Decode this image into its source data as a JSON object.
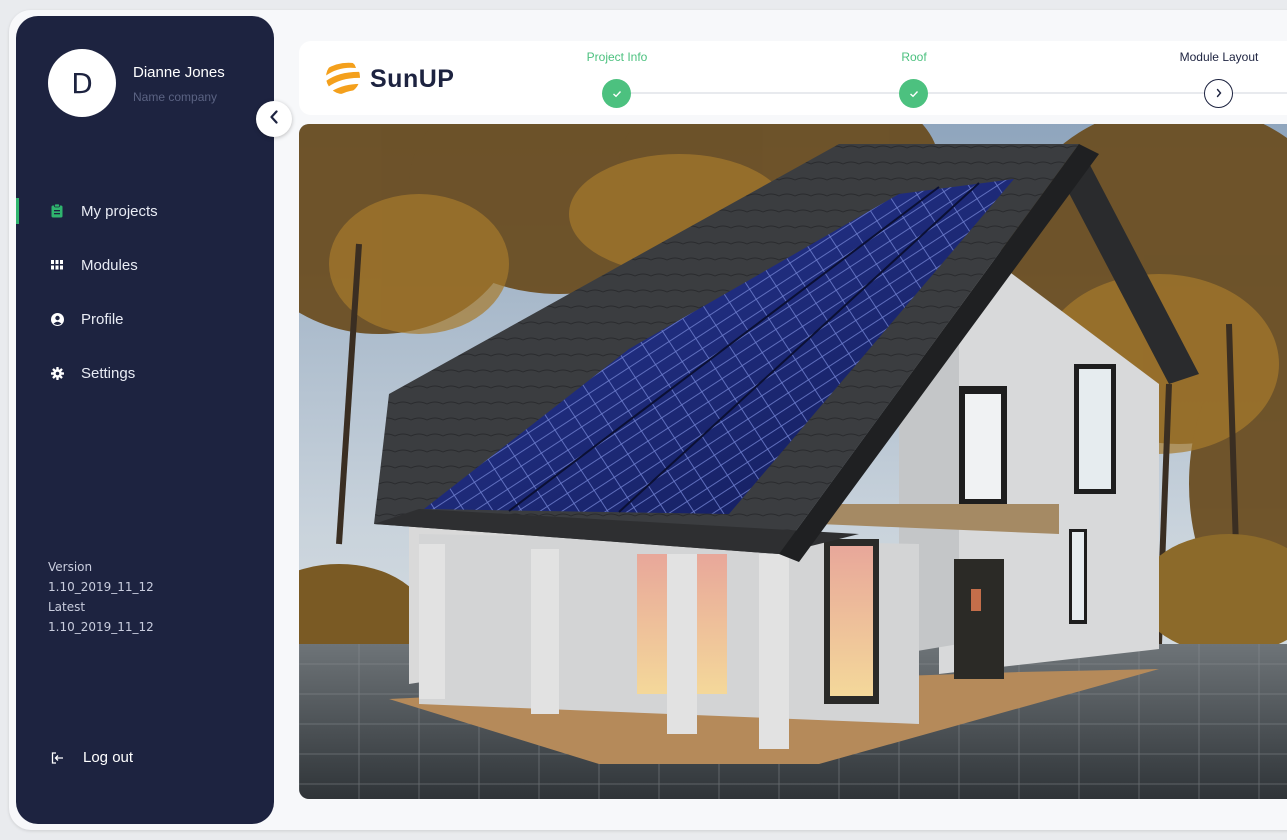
{
  "user": {
    "initial": "D",
    "name": "Dianne Jones",
    "company": "Name company"
  },
  "nav": {
    "items": [
      {
        "label": "My projects",
        "icon": "clipboard-icon",
        "active": true
      },
      {
        "label": "Modules",
        "icon": "grid-icon",
        "active": false
      },
      {
        "label": "Profile",
        "icon": "user-circle-icon",
        "active": false
      },
      {
        "label": "Settings",
        "icon": "gear-icon",
        "active": false
      }
    ],
    "logout_label": "Log out"
  },
  "version": {
    "version_label": "Version",
    "version_value": "1.10_2019_11_12",
    "latest_label": "Latest",
    "latest_value": "1.10_2019_11_12"
  },
  "brand": {
    "name": "SunUP",
    "logo_icon": "sun-stripes-logo"
  },
  "steps": [
    {
      "label": "Project Info",
      "status": "done"
    },
    {
      "label": "Roof",
      "status": "done"
    },
    {
      "label": "Module Layout",
      "status": "current"
    }
  ],
  "colors": {
    "sidebar": "#1d2340",
    "accent_green": "#4cc17f",
    "brand_orange": "#f4a01c"
  },
  "scene": {
    "icon": "house-with-solar-panels-render"
  }
}
